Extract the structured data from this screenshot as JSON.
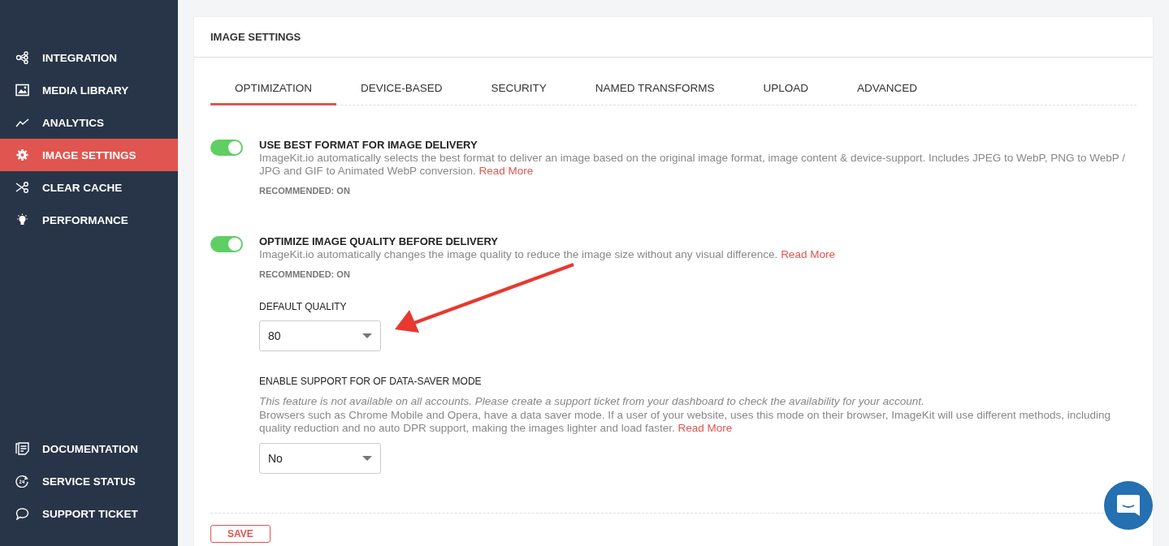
{
  "sidebar": {
    "top_items": [
      {
        "label": "INTEGRATION",
        "selected": false
      },
      {
        "label": "MEDIA LIBRARY",
        "selected": false
      },
      {
        "label": "ANALYTICS",
        "selected": false
      },
      {
        "label": "IMAGE SETTINGS",
        "selected": true
      },
      {
        "label": "CLEAR CACHE",
        "selected": false
      },
      {
        "label": "PERFORMANCE",
        "selected": false
      }
    ],
    "bottom_items": [
      {
        "label": "DOCUMENTATION",
        "selected": false
      },
      {
        "label": "SERVICE STATUS",
        "selected": false
      },
      {
        "label": "SUPPORT TICKET",
        "selected": false
      }
    ]
  },
  "card": {
    "title": "IMAGE SETTINGS",
    "tabs": [
      {
        "label": "OPTIMIZATION",
        "selected": true
      },
      {
        "label": "DEVICE-BASED",
        "selected": false
      },
      {
        "label": "SECURITY",
        "selected": false
      },
      {
        "label": "NAMED TRANSFORMS",
        "selected": false
      },
      {
        "label": "UPLOAD",
        "selected": false
      },
      {
        "label": "ADVANCED",
        "selected": false
      }
    ],
    "toggles": [
      {
        "title": "USE BEST FORMAT FOR IMAGE DELIVERY",
        "description": "ImageKit.io automatically selects the best format to deliver an image based on the original image format, image content & device-support. Includes JPEG to WebP, PNG to WebP / JPG and GIF to Animated WebP conversion.",
        "link": "Read More",
        "recommendation": "RECOMMENDED: ON",
        "on": true
      },
      {
        "title": "OPTIMIZE IMAGE QUALITY BEFORE DELIVERY",
        "description": "ImageKit.io automatically changes the image quality to reduce the image size without any visual difference.",
        "link": "Read More",
        "recommendation": "RECOMMENDED: ON",
        "on": true
      }
    ],
    "default_quality": {
      "label": "DEFAULT QUALITY",
      "value": "80"
    },
    "data_saver": {
      "label": "ENABLE SUPPORT FOR OF DATA-SAVER MODE",
      "note": "This feature is not available on all accounts. Please create a support ticket from your dashboard to check the availability for your account.",
      "description": "Browsers such as Chrome Mobile and Opera, have a data saver mode. If a user of your website, uses this mode on their browser, ImageKit will use different methods, including quality reduction and no auto DPR support, making the images lighter and load faster.",
      "link": "Read More",
      "value": "No"
    },
    "save_button": "SAVE"
  }
}
